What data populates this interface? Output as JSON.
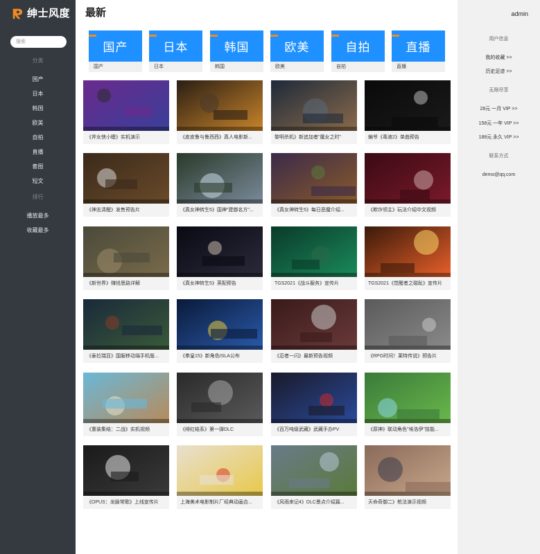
{
  "brand": {
    "name": "绅士风度"
  },
  "search": {
    "placeholder": "搜索"
  },
  "sidebar": {
    "category_head": "分类",
    "categories": [
      "国产",
      "日本",
      "韩国",
      "欧美",
      "自拍",
      "直播",
      "套图",
      "短文"
    ],
    "ranking_head": "排行",
    "ranking": [
      "播放最多",
      "收藏最多"
    ]
  },
  "main": {
    "title": "最新",
    "category_cards": [
      {
        "label": "国产",
        "caption": "国产"
      },
      {
        "label": "日本",
        "caption": "日本"
      },
      {
        "label": "韩国",
        "caption": "韩国"
      },
      {
        "label": "欧美",
        "caption": "欧美"
      },
      {
        "label": "自拍",
        "caption": "自拍"
      },
      {
        "label": "直播",
        "caption": "直播"
      }
    ],
    "videos": [
      {
        "caption": "《斧女侠小睫》实机演示",
        "palette": [
          "#6a2a8c",
          "#3a3f9a",
          "#2c2c2c"
        ]
      },
      {
        "caption": "《皮皮鲁与鲁西西》真人电影新...",
        "palette": [
          "#2a1e14",
          "#c8842a",
          "#4a3a2a"
        ]
      },
      {
        "caption": "黎明杀机》新追加者\"魔女之时\"",
        "palette": [
          "#1e2a3a",
          "#8a6a4a",
          "#5a6a7a"
        ]
      },
      {
        "caption": "蝙爷《毒液2》单曲预告",
        "palette": [
          "#0a0a0a",
          "#1a1a1a",
          "#b8b8b8"
        ]
      },
      {
        "caption": "《神志清醒》发售预告片",
        "palette": [
          "#3a2a1a",
          "#6a4a2a",
          "#d8d8d8"
        ]
      },
      {
        "caption": "《真女神转生5》国神\"建御名方\"...",
        "palette": [
          "#2a3a2a",
          "#7a8a9a",
          "#c8d8e8"
        ]
      },
      {
        "caption": "《真女神转生5》每日恶魔介绍...",
        "palette": [
          "#3a2a4a",
          "#8a5a2a",
          "#5a7a3a"
        ]
      },
      {
        "caption": "《欺诈领主》玩法介绍中文视频",
        "palette": [
          "#3a0a14",
          "#7a1a2a",
          "#c8a8a8"
        ]
      },
      {
        "caption": "《新世界》赚钱思路详解",
        "palette": [
          "#4a4a3a",
          "#7a6a4a",
          "#9a8a6a"
        ]
      },
      {
        "caption": "《真女神转生5》英配预告",
        "palette": [
          "#0a0a14",
          "#2a2a3a",
          "#c8b8a8"
        ]
      },
      {
        "caption": "TGS2021《战斗服务》宣传片",
        "palette": [
          "#0a3a2a",
          "#1a8a5a",
          "#2a6a4a"
        ]
      },
      {
        "caption": "TGS2021《觉醒者之碰趾》宣传片",
        "palette": [
          "#3a1a0a",
          "#e8602a",
          "#ffd86a"
        ]
      },
      {
        "caption": "《泰拉瑞亚》国服移动端手机版...",
        "palette": [
          "#1a2a3a",
          "#3a5a3a",
          "#8a3a2a"
        ]
      },
      {
        "caption": "《拳皇15》新角色ISLA公布",
        "palette": [
          "#0a1a3a",
          "#2a5aaa",
          "#e8c83a"
        ]
      },
      {
        "caption": "《忍者一闪》最新预告视频",
        "palette": [
          "#3a1a1a",
          "#6a3a3a",
          "#c8c8c8"
        ]
      },
      {
        "caption": "《RPG时间！莱特传说》预告片",
        "palette": [
          "#5a5a5a",
          "#8a8a8a",
          "#c8c8c8"
        ]
      },
      {
        "caption": "《重装集结：二战》实机视频",
        "palette": [
          "#6ab8d8",
          "#b88a5a",
          "#e8e0c8"
        ]
      },
      {
        "caption": "《绯红结系》第一弹DLC",
        "palette": [
          "#2a2a2a",
          "#5a5a5a",
          "#a8a8a8"
        ]
      },
      {
        "caption": "《百万吨级武藏》武藏手办PV",
        "palette": [
          "#1a1a2a",
          "#2a4a9a",
          "#c82a2a"
        ]
      },
      {
        "caption": "《原神》联动角色\"埃洛伊\"技能...",
        "palette": [
          "#3a7a3a",
          "#6ab84a",
          "#8ad8e8"
        ]
      },
      {
        "caption": "《OPUS：龙脉常歌》上线宣传片",
        "palette": [
          "#1a1a1a",
          "#3a3a3a",
          "#e8e8e8"
        ]
      },
      {
        "caption": "上海美术电影制片厂经典动画合...",
        "palette": [
          "#e8e0d0",
          "#e8c84a",
          "#d83a2a"
        ]
      },
      {
        "caption": "《风雨来记4》DLC景点介绍篇...",
        "palette": [
          "#6a7a8a",
          "#5a7a3a",
          "#b8c8d8"
        ]
      },
      {
        "caption": "天命奇御二》枪法演示视频",
        "palette": [
          "#8a6a5a",
          "#c8a88a",
          "#3a3a4a"
        ]
      }
    ]
  },
  "right_panel": {
    "user": "admin",
    "user_info_head": "用户信息",
    "user_links": [
      "我的收藏 >>",
      "历史足迹 >>"
    ],
    "vip_head": "无限尽享",
    "vip_links": [
      "28元 一月 VIP >>",
      "158元 一年 VIP >>",
      "188元 永久 VIP >>"
    ],
    "contact_head": "联系方式",
    "contact_email": "demo@qq.com"
  },
  "colors": {
    "sidebar_bg": "#343a40",
    "accent_blue": "#1e90ff",
    "accent_orange": "#f08a24",
    "right_panel_bg": "#f1f1f1"
  },
  "icons": {
    "logo": "brand-logo-icon"
  }
}
